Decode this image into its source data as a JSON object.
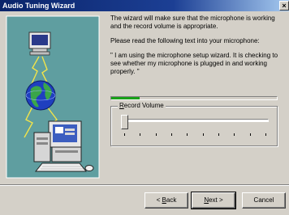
{
  "window": {
    "title": "Audio Tuning Wizard",
    "close_glyph": "×"
  },
  "illustration": {
    "icon_names": [
      "monitor-icon",
      "globe-icon",
      "desktop-computer-icon",
      "keyboard-icon",
      "mouse-icon",
      "lightning-cable-icon"
    ]
  },
  "content": {
    "paragraph1": "The wizard will make sure that the microphone is working and the record volume is appropriate.",
    "paragraph2": "Please read the following text into your microphone:",
    "paragraph3": "\" I am using the microphone setup wizard. It is checking to see whether my microphone is plugged in and working properly. \""
  },
  "level_meter": {
    "level_fraction": 0.17,
    "fill_color": "#19a119"
  },
  "record_volume": {
    "label_prefix": "",
    "label_mnemonic": "R",
    "label_rest": "ecord Volume",
    "slider_value_fraction": 0.0,
    "tick_count": 10
  },
  "buttons": {
    "back_prefix": "< ",
    "back_mnemonic": "B",
    "back_rest": "ack",
    "next_mnemonic": "N",
    "next_rest": "ext >",
    "cancel_label": "Cancel"
  }
}
